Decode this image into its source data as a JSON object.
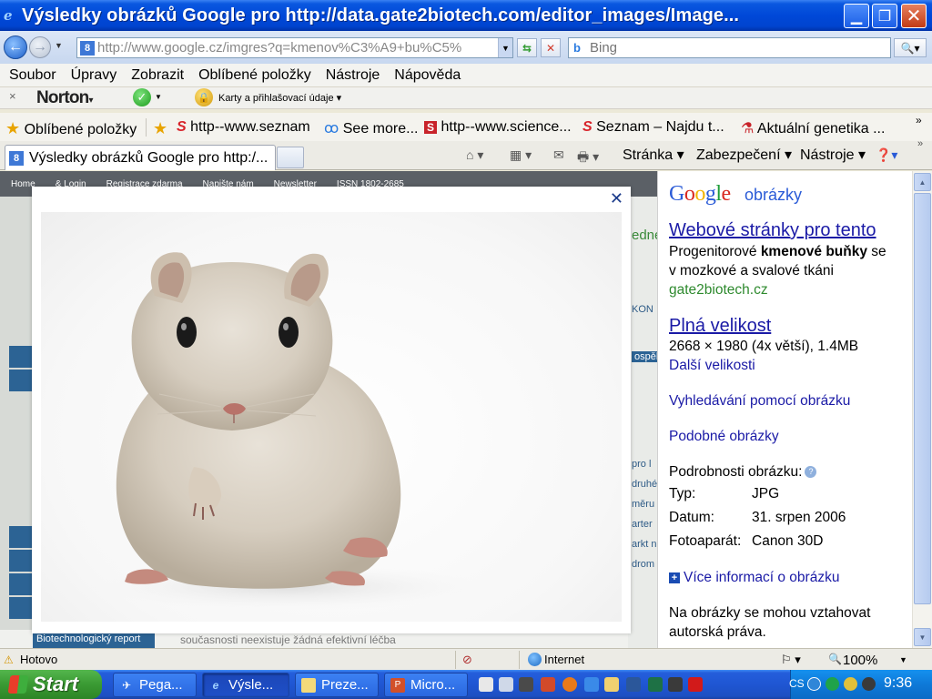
{
  "window": {
    "title": "Výsledky obrázků Google pro http://data.gate2biotech.com/editor_images/Image...",
    "min_glyph": "▁",
    "max_glyph": "❐",
    "close_glyph": "✕"
  },
  "address": {
    "url": "http://www.google.cz/imgres?q=kmenov%C3%A9+bu%C5%",
    "search_placeholder": "Bing"
  },
  "menu": [
    "Soubor",
    "Úpravy",
    "Zobrazit",
    "Oblíbené položky",
    "Nástroje",
    "Nápověda"
  ],
  "norton": {
    "close": "×",
    "logo": "Norton",
    "identity_safe": "Karty a přihlašovací údaje ▾"
  },
  "favorites": {
    "label": "Oblíbené položky",
    "items": [
      "http--www.seznam",
      "See more...",
      "http--www.science...",
      "Seznam – Najdu t...",
      "Aktuální genetika ..."
    ]
  },
  "tabs": {
    "active": "Výsledky obrázků Google pro http:/..."
  },
  "commandbar": {
    "page": "Stránka ▾",
    "security": "Zabezpečení ▾",
    "tools": "Nástroje ▾"
  },
  "background_page": {
    "nav": [
      "Home",
      "& Login",
      "Registrace zdarma",
      "Napište nám",
      "Newsletter",
      "ISSN 1802-2685"
    ],
    "right_fragments": [
      "edne",
      "KON",
      "ospěl",
      "pro l",
      "druhé",
      "měru",
      "arter",
      "arkt ne",
      "drom"
    ],
    "report_label": "Biotechnologický report",
    "footer_text": "současnosti neexistuje žádná efektivní léčba"
  },
  "panel": {
    "logo": {
      "G": "G",
      "o1": "o",
      "o2": "o",
      "g": "g",
      "l": "l",
      "e": "e"
    },
    "logo_sub": "obrázky",
    "web_link": "Webové stránky pro tento",
    "snippet_pre": "Progenitorové ",
    "snippet_bold": "kmenové buňky",
    "snippet_post": " se",
    "snippet_line2": "v mozkové a svalové tkáni",
    "domain": "gate2biotech.cz",
    "full_size_link": "Plná velikost",
    "dimensions": "2668 × 1980 (4x větší), 1.4MB",
    "more_sizes": "Další velikosti",
    "search_by_image": "Vyhledávání pomocí obrázku",
    "similar": "Podobné obrázky",
    "details_label": "Podrobnosti obrázku:",
    "details": [
      {
        "label": "Typ:",
        "value": "JPG"
      },
      {
        "label": "Datum:",
        "value": "31. srpen 2006"
      },
      {
        "label": "Fotoaparát:",
        "value": "Canon 30D"
      }
    ],
    "more_info": "Více informací o obrázku",
    "copyright_1": "Na obrázky se mohou vztahovat",
    "copyright_2": "autorská práva."
  },
  "status": {
    "text": "Hotovo",
    "zone": "Internet",
    "zoom": "100%"
  },
  "taskbar": {
    "start": "Start",
    "buttons": [
      "Pega...",
      "Výsle...",
      "Preze...",
      "Micro..."
    ],
    "lang": "CS",
    "clock": "9:36"
  },
  "colors": {
    "title_blue": "#0048d8",
    "link_blue": "#1a1aa6",
    "green": "#2e8a2e",
    "start_green": "#3a9a33"
  }
}
